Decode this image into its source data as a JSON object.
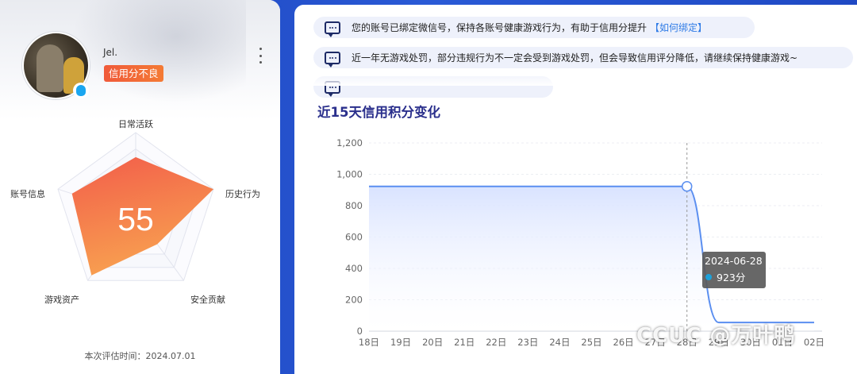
{
  "profile": {
    "username": "Jel.",
    "credit_badge": "信用分不良",
    "score": "55",
    "eval_time": "本次评估时间：2024.07.01"
  },
  "radar": {
    "dimensions": [
      "日常活跃",
      "历史行为",
      "安全贡献",
      "游戏资产",
      "账号信息"
    ],
    "levels": [
      0.7,
      1.0,
      0.45,
      0.92,
      0.82
    ],
    "fill_from": "#f25d4a",
    "fill_to": "#f8a050"
  },
  "notices": [
    {
      "text": "您的账号已绑定微信号，保持各账号健康游戏行为，有助于信用分提升",
      "link": "【如何绑定】"
    },
    {
      "text": "近一年无游戏处罚，部分违规行为不一定会受到游戏处罚，但会导致信用评分降低，请继续保持健康游戏~",
      "link": ""
    },
    {
      "text": "",
      "link": ""
    }
  ],
  "chart_title": "近15天信用积分变化",
  "chart_data": {
    "type": "area",
    "categories": [
      "18日",
      "19日",
      "20日",
      "21日",
      "22日",
      "23日",
      "24日",
      "25日",
      "26日",
      "27日",
      "28日",
      "29日",
      "30日",
      "01日",
      "02日"
    ],
    "values": [
      923,
      923,
      923,
      923,
      923,
      923,
      923,
      923,
      923,
      923,
      923,
      55,
      55,
      55,
      55
    ],
    "yticks": [
      "0",
      "200",
      "400",
      "600",
      "800",
      "1,000",
      "1,200"
    ],
    "ylim": [
      0,
      1200
    ],
    "line_color": "#5b8ff0",
    "area_color": "#d9e3ff",
    "tooltip": {
      "date": "2024-06-28",
      "value": "923分"
    }
  },
  "watermark": "CCUC @万叶鸭"
}
